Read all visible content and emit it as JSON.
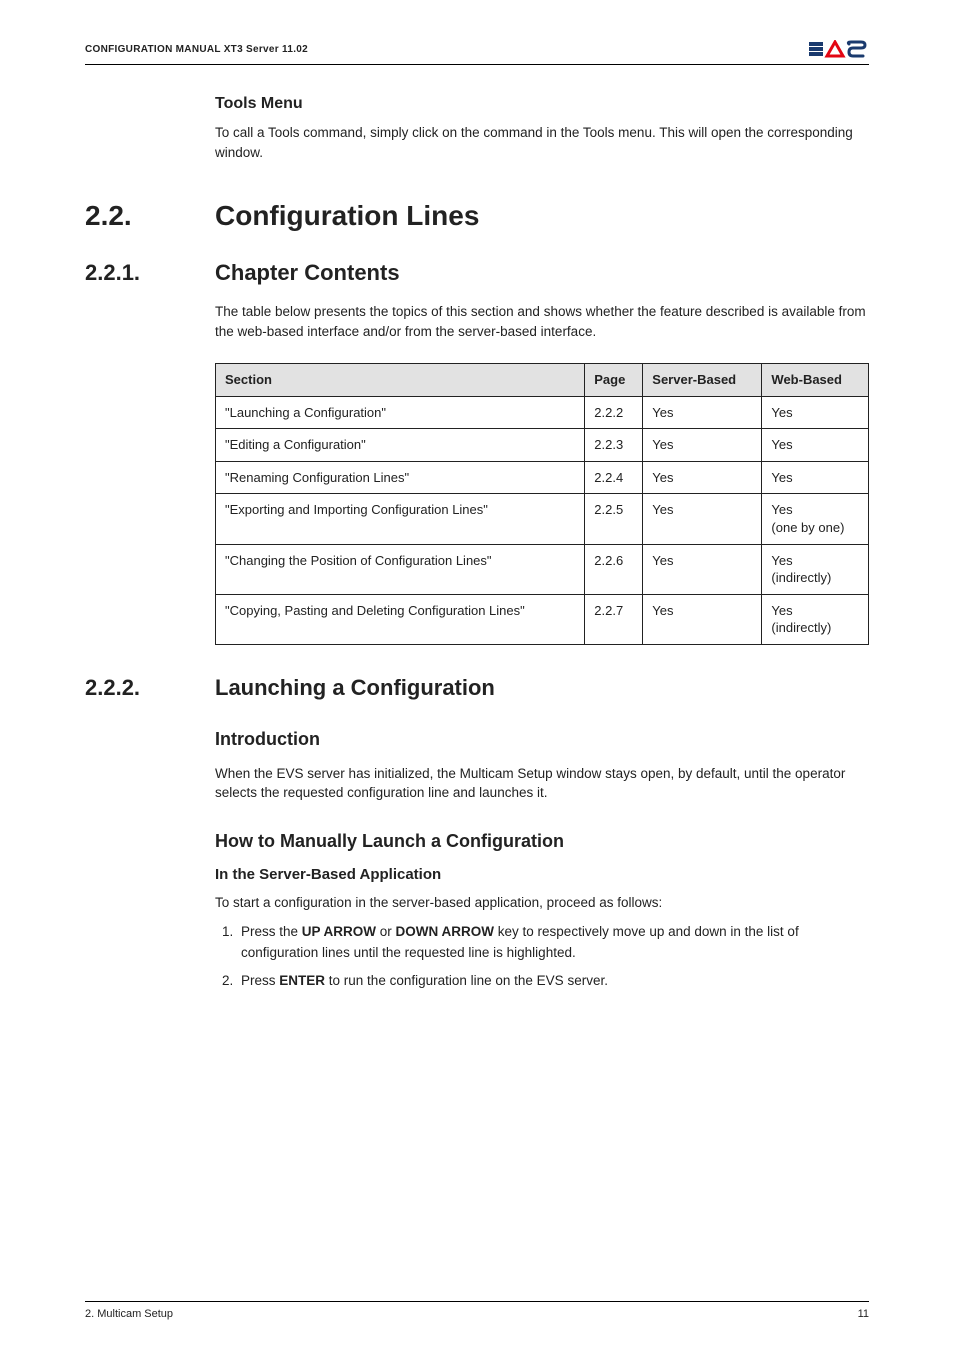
{
  "header": {
    "title": "CONFIGURATION MANUAL  XT3  Server 11.02"
  },
  "tools_menu": {
    "heading": "Tools Menu",
    "text": "To call a Tools command, simply click on the command in the Tools menu. This will open the corresponding window."
  },
  "section22": {
    "num": "2.2.",
    "title": "Configuration Lines"
  },
  "section221": {
    "num": "2.2.1.",
    "title": "Chapter Contents",
    "intro": "The table below presents the topics of this section and shows whether the feature described is available from the web-based interface and/or from the server-based interface."
  },
  "table": {
    "headers": [
      "Section",
      "Page",
      "Server-Based",
      "Web-Based"
    ],
    "rows": [
      {
        "section": "\"Launching a Configuration\"",
        "page": "2.2.2",
        "server": "Yes",
        "web": "Yes"
      },
      {
        "section": "\"Editing a Configuration\"",
        "page": "2.2.3",
        "server": "Yes",
        "web": "Yes"
      },
      {
        "section": "\"Renaming Configuration Lines\"",
        "page": "2.2.4",
        "server": "Yes",
        "web": "Yes"
      },
      {
        "section": "\"Exporting and Importing Configuration Lines\"",
        "page": "2.2.5",
        "server": "Yes",
        "web": "Yes\n(one by one)"
      },
      {
        "section": "\"Changing the Position of Configuration Lines\"",
        "page": "2.2.6",
        "server": "Yes",
        "web": "Yes\n(indirectly)"
      },
      {
        "section": "\"Copying, Pasting and Deleting Configuration Lines\"",
        "page": "2.2.7",
        "server": "Yes",
        "web": "Yes\n(indirectly)"
      }
    ]
  },
  "section222": {
    "num": "2.2.2.",
    "title": "Launching a Configuration",
    "intro_heading": "Introduction",
    "intro_text": "When the EVS server has initialized, the Multicam Setup window stays open, by default, until the operator selects the requested configuration line and launches it.",
    "howto_heading": "How to Manually Launch a Configuration",
    "sub_heading": "In the Server-Based Application",
    "sub_text": "To start a configuration in the server-based application, proceed as follows:",
    "step1_a": "Press the ",
    "step1_b": "UP ARROW",
    "step1_c": " or ",
    "step1_d": "DOWN ARROW",
    "step1_e": " key to respectively move up and down in the list of configuration lines until the requested line is highlighted.",
    "step2_a": "Press ",
    "step2_b": "ENTER",
    "step2_c": " to run the configuration line on the EVS server."
  },
  "footer": {
    "left": "2. Multicam Setup",
    "right": "11"
  }
}
